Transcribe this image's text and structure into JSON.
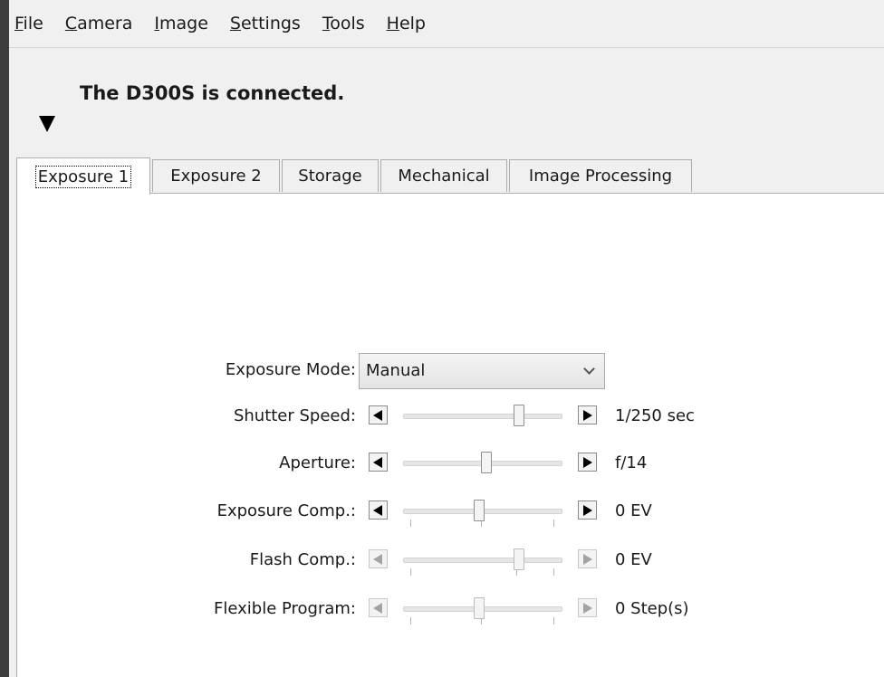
{
  "menubar": {
    "items": [
      {
        "mnemonic": "F",
        "rest": "ile"
      },
      {
        "mnemonic": "C",
        "rest": "amera"
      },
      {
        "mnemonic": "I",
        "rest": "mage"
      },
      {
        "mnemonic": "S",
        "rest": "ettings"
      },
      {
        "mnemonic": "T",
        "rest": "ools"
      },
      {
        "mnemonic": "H",
        "rest": "elp"
      }
    ]
  },
  "status": {
    "text": "The D300S is connected.",
    "toggle_icon": "collapse-triangle-down"
  },
  "tabs": [
    {
      "label": "Exposure 1",
      "active": true
    },
    {
      "label": "Exposure 2",
      "active": false
    },
    {
      "label": "Storage",
      "active": false
    },
    {
      "label": "Mechanical",
      "active": false
    },
    {
      "label": "Image Processing",
      "active": false
    }
  ],
  "exposure1": {
    "mode": {
      "label": "Exposure Mode:",
      "value": "Manual"
    },
    "sliders": [
      {
        "label": "Shutter Speed:",
        "value": "1/250 sec",
        "position": 0.73,
        "enabled": true,
        "ticks": false
      },
      {
        "label": "Aperture:",
        "value": "f/14",
        "position": 0.52,
        "enabled": true,
        "ticks": false
      },
      {
        "label": "Exposure Comp.:",
        "value": "0 EV",
        "position": 0.48,
        "enabled": true,
        "ticks": true
      },
      {
        "label": "Flash Comp.:",
        "value": "0 EV",
        "position": 0.73,
        "enabled": false,
        "ticks": true
      },
      {
        "label": "Flexible Program:",
        "value": "0 Step(s)",
        "position": 0.48,
        "enabled": false,
        "ticks": true
      }
    ]
  },
  "colors": {
    "window_bg": "#f0f0f0",
    "panel_bg": "#ffffff",
    "frame": "#3c3c3c",
    "disabled_arrow": "#a3a3a3"
  }
}
